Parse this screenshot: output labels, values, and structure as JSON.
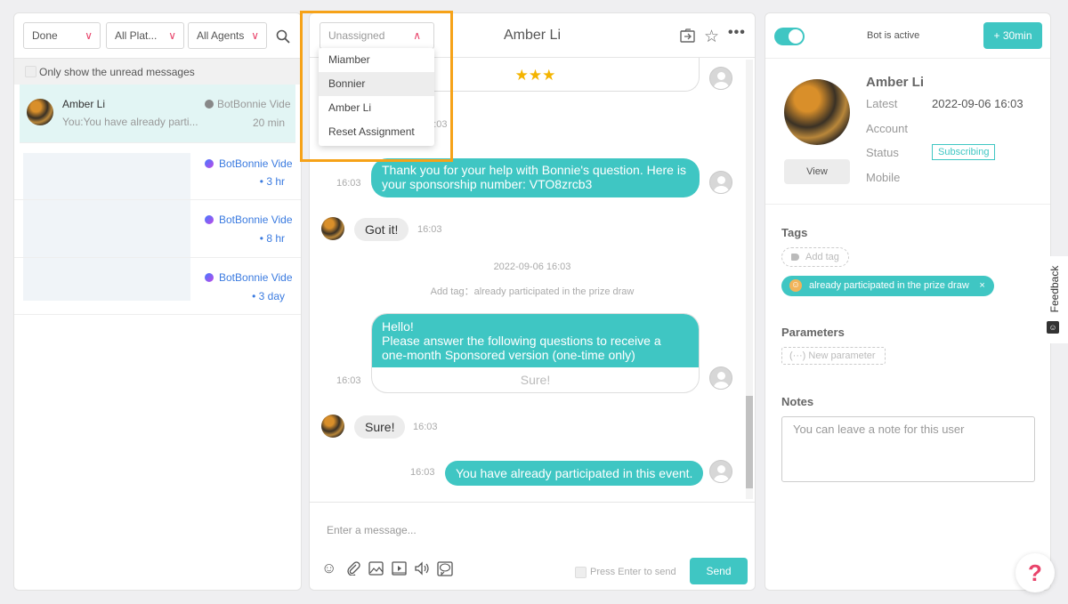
{
  "filters": {
    "status": "Done",
    "platform": "All Plat...",
    "agents": "All Agents"
  },
  "unread_label": "Only show the unread messages",
  "conversations": [
    {
      "name": "Amber Li",
      "preview": "You:You have already parti...",
      "bot": "BotBonnie Vide",
      "time": "20 min"
    },
    {
      "bot": "BotBonnie Vide",
      "time": "• 3 hr"
    },
    {
      "bot": "BotBonnie Vide",
      "time": "• 8 hr"
    },
    {
      "bot": "BotBonnie Vide",
      "time": "• 3 day"
    }
  ],
  "assign": {
    "current": "Unassigned",
    "options": [
      "Miamber",
      "Bonnier",
      "Amber Li",
      "Reset Assignment"
    ]
  },
  "chat": {
    "title": "Amber Li",
    "stars": "★★★",
    "msg1": "Thank you for your help with Bonnie's question. Here is your sponsorship number: VTO8zrcb3",
    "msg1_time": "16:03",
    "hidden_time": "16:03",
    "msg2": "Got it!",
    "msg2_time": "16:03",
    "date_sep": "2022-09-06 16:03",
    "tag_note": "Add tag：already participated in the prize draw",
    "msg3": "Hello!\nPlease answer the following questions to receive a one-month Sponsored version (one-time only)",
    "msg3_button": "Sure!",
    "msg3_time": "16:03",
    "msg4": "Sure!",
    "msg4_time": "16:03",
    "msg5": "You have already participated in this event.",
    "msg5_time": "16:03",
    "input_placeholder": "Enter a message...",
    "press_enter": "Press Enter to send",
    "send": "Send"
  },
  "profile": {
    "bot_status": "Bot is active",
    "extend": "+ 30min",
    "name": "Amber Li",
    "latest_label": "Latest",
    "latest_value": "2022-09-06 16:03",
    "account_label": "Account",
    "status_label": "Status",
    "status_value": "Subscribing",
    "mobile_label": "Mobile",
    "view": "View",
    "tags_title": "Tags",
    "add_tag": "Add tag",
    "tag1": "already participated in the prize draw",
    "params_title": "Parameters",
    "new_param": "New parameter",
    "notes_title": "Notes",
    "notes_placeholder": "You can leave a note for this user"
  },
  "feedback": "Feedback",
  "help": "?",
  "colors": {
    "accent": "#3fc6c3",
    "highlight": "#f6a218",
    "chevron": "#e8436a"
  }
}
